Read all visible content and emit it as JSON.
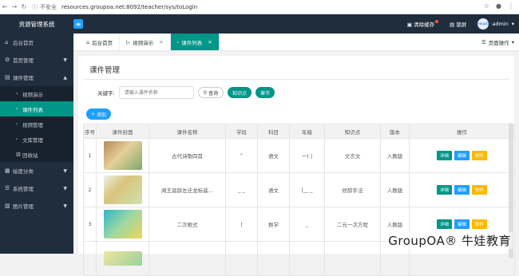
{
  "browser": {
    "not_secure": "不安全",
    "url": "resources.groupoa.net:8092/teacher/sys/toLogin"
  },
  "app": {
    "title": "资源管理系统",
    "clear_cache": "清除缓存",
    "lock": "锁屏",
    "avatar_text": "GroupOA",
    "user": "admin"
  },
  "sidebar": {
    "items": [
      {
        "label": "后台首页"
      },
      {
        "label": "首页管理"
      },
      {
        "label": "课件管理"
      }
    ],
    "sub_items": [
      {
        "label": "视频演示"
      },
      {
        "label": "课件列表"
      },
      {
        "label": "视频管理"
      },
      {
        "label": "文库管理"
      },
      {
        "label": "回收站"
      }
    ],
    "items_after": [
      {
        "label": "绘度分类"
      },
      {
        "label": "系统管理"
      },
      {
        "label": "图片管理"
      }
    ]
  },
  "tabs": [
    {
      "label": "后台首页"
    },
    {
      "label": "视频演示"
    },
    {
      "label": "课件列表"
    }
  ],
  "page_ops": "页面操作",
  "content": {
    "title": "课件管理",
    "search_label": "关键字:",
    "search_placeholder": "请输入课件名称",
    "query_btn": "查询",
    "knowledge_btn": "知识点",
    "chapter_btn": "章节",
    "add_btn": "添加"
  },
  "table": {
    "headers": [
      "序号",
      "课件封面",
      "课件名称",
      "学段",
      "科目",
      "年级",
      "知识点",
      "版本",
      "操作"
    ],
    "rows": [
      {
        "num": "1",
        "name": "古代诗歌四首",
        "stage": "\"",
        "subject": "语文",
        "grade": "一(    |",
        "knowledge": "文言文",
        "version": "人教版"
      },
      {
        "num": "2",
        "name": "闻王昌龄左迁龙标遥...",
        "stage": "_ _",
        "subject": "语文",
        "grade": "|__ _",
        "knowledge": "修辞手法",
        "version": "人教版"
      },
      {
        "num": "3",
        "name": "二次根式",
        "stage": "|",
        "subject": "数学",
        "grade": "_",
        "knowledge": "二元一次方程",
        "version": "人教版"
      }
    ],
    "actions": {
      "detail": "详细",
      "edit": "编辑",
      "attach": "附件"
    }
  },
  "watermark": "GroupOA® 牛娃教育"
}
